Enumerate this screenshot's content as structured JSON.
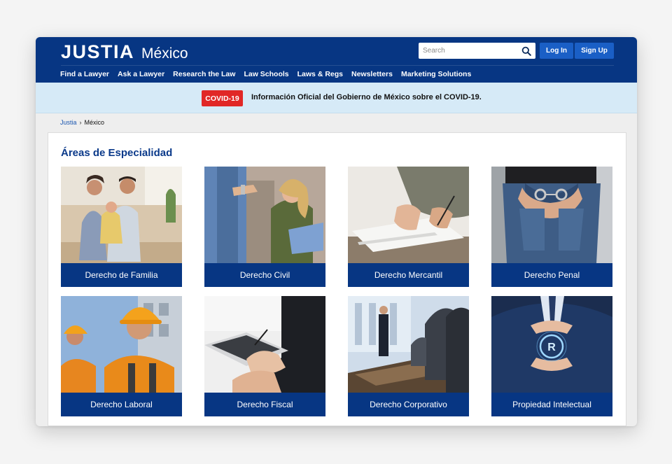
{
  "header": {
    "logo": "JUSTIA",
    "region": "México",
    "search_placeholder": "Search",
    "login_label": "Log In",
    "signup_label": "Sign Up",
    "nav": [
      "Find a Lawyer",
      "Ask a Lawyer",
      "Research the Law",
      "Law Schools",
      "Laws & Regs",
      "Newsletters",
      "Marketing Solutions"
    ]
  },
  "banner": {
    "badge": "COVID-19",
    "link_text": "Información Oficial del Gobierno de México sobre el COVID-19."
  },
  "breadcrumb": {
    "root": "Justia",
    "separator": "›",
    "current": "México"
  },
  "main": {
    "title": "Áreas de Especialidad",
    "areas": [
      {
        "label": "Derecho de Familia"
      },
      {
        "label": "Derecho Civil"
      },
      {
        "label": "Derecho Mercantil"
      },
      {
        "label": "Derecho Penal"
      },
      {
        "label": "Derecho Laboral"
      },
      {
        "label": "Derecho Fiscal"
      },
      {
        "label": "Derecho Corporativo"
      },
      {
        "label": "Propiedad Intelectual"
      }
    ]
  },
  "icons": {
    "search": "search-icon"
  },
  "colors": {
    "brand_blue": "#073683",
    "button_blue": "#1a5fc6",
    "banner_bg": "#d6eaf7",
    "covid_red": "#e12726",
    "title_blue": "#0b3a8a"
  }
}
